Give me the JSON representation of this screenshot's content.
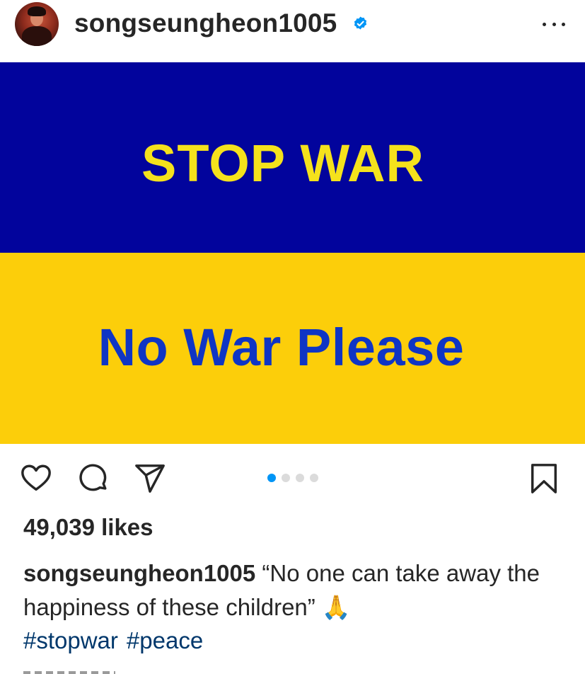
{
  "post": {
    "username": "songseungheon1005",
    "verified": true,
    "image": {
      "top_text": "STOP WAR",
      "bottom_text": "No War Please",
      "top_color": "#02049c",
      "bottom_color": "#fcce0a"
    },
    "actions": {
      "like_icon": "heart-icon",
      "comment_icon": "comment-icon",
      "share_icon": "share-icon",
      "save_icon": "bookmark-icon"
    },
    "carousel": {
      "total": 4,
      "active": 1
    },
    "likes": "49,039 likes",
    "caption": {
      "username": "songseungheon1005",
      "text": "“No one can take away the happiness of these children” 🙏"
    },
    "hashtags": [
      "#stopwar",
      "#peace"
    ]
  },
  "colors": {
    "accent_blue": "#0095f6",
    "hashtag_blue": "#00376b",
    "text": "#262626"
  }
}
